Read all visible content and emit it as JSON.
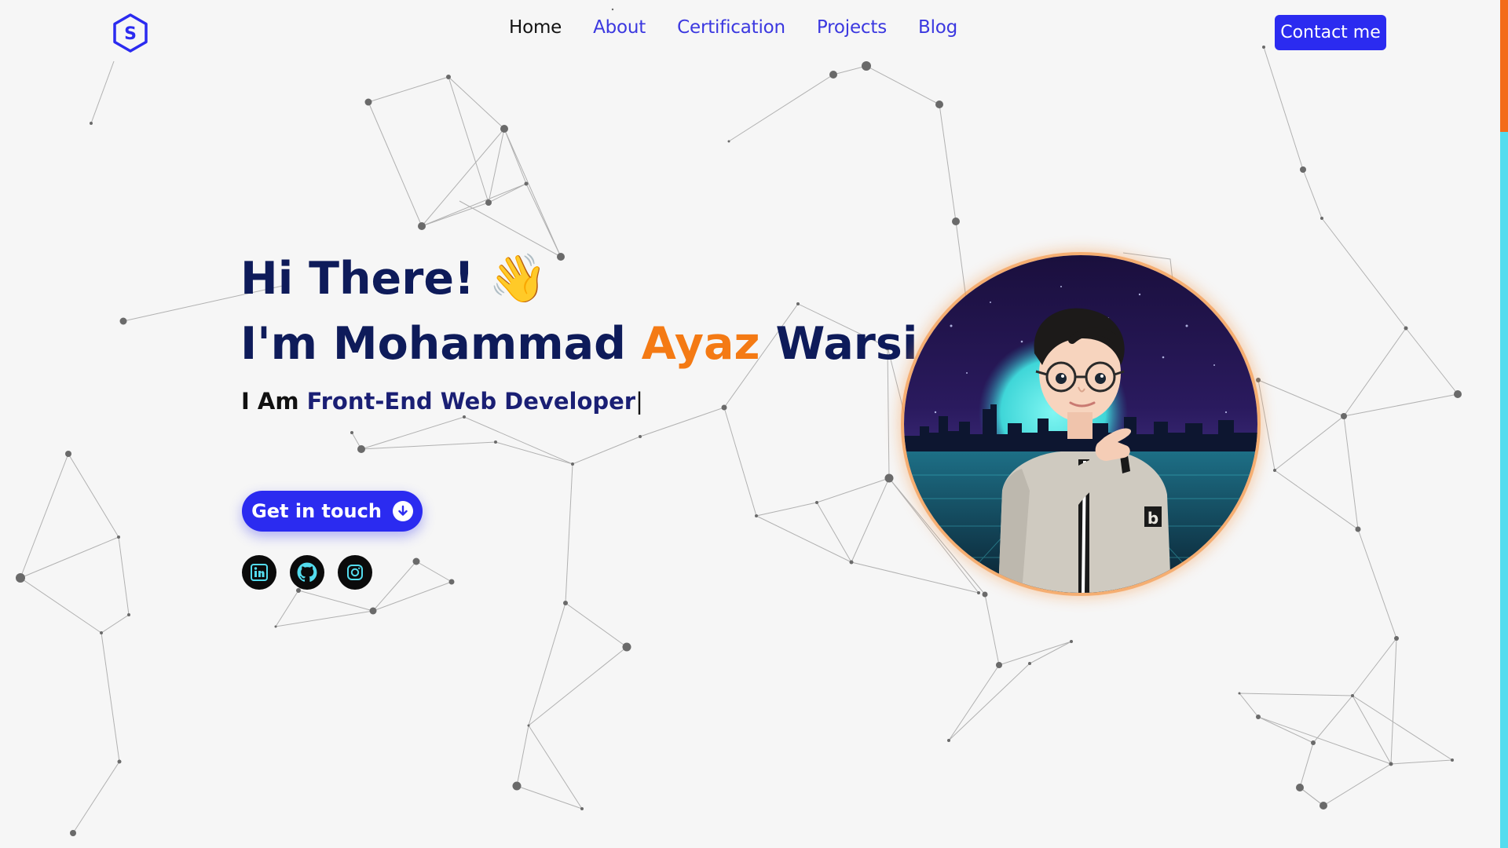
{
  "header": {
    "logo_letter": "S",
    "nav": [
      {
        "label": "Home",
        "active": true
      },
      {
        "label": "About",
        "active": false
      },
      {
        "label": "Certification",
        "active": false
      },
      {
        "label": "Projects",
        "active": false
      },
      {
        "label": "Blog",
        "active": false
      }
    ],
    "contact_label": "Contact me"
  },
  "hero": {
    "greeting": "Hi There!",
    "wave_emoji": "👋",
    "intro_prefix": "I'm Mohammad",
    "name_accent": "Ayaz",
    "name_last": "Warsi",
    "tagline_prefix": "I Am",
    "tagline_role": "Front-End Web Developer",
    "caret": "|",
    "cta_label": "Get in touch"
  },
  "socials": [
    {
      "name": "linkedin-icon"
    },
    {
      "name": "github-icon"
    },
    {
      "name": "instagram-icon"
    }
  ],
  "colors": {
    "background": "#f6f6f6",
    "primary": "#2b2bf0",
    "heading": "#0e1b5a",
    "accent": "#f47a14",
    "social_icon": "#53dcee",
    "scroll_track": "#53dcee",
    "scroll_thumb": "#f36b1a"
  }
}
